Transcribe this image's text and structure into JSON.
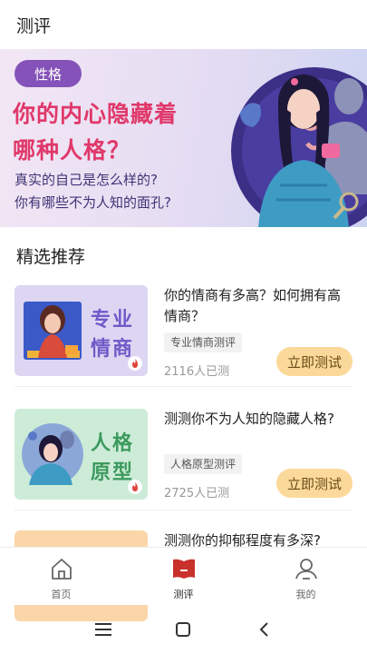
{
  "header": {
    "title": "测评"
  },
  "banner": {
    "tag": "性格",
    "headline_1": "你的内心隐藏着",
    "headline_2": "哪种人格？",
    "subline_1": "真实的自己是怎么样的?",
    "subline_2": "你有哪些不为人知的面孔?"
  },
  "section": {
    "title": "精选推荐"
  },
  "cards": [
    {
      "thumb_word_1": "专业",
      "thumb_word_2": "情商",
      "question": "你的情商有多高？如何拥有高情商？",
      "tag": "专业情商测评",
      "count": "2116人已测",
      "button": "立即测试",
      "thumb_color": "#dcd6f3",
      "word_color": "#6f5bc8"
    },
    {
      "thumb_word_1": "人格",
      "thumb_word_2": "原型",
      "question": "测测你不为人知的隐藏人格?",
      "tag": "人格原型测评",
      "count": "2725人已测",
      "button": "立即测试",
      "thumb_color": "#cdecd8",
      "word_color": "#3d9a5e"
    },
    {
      "question": "测测你的抑郁程度有多深?",
      "thumb_color": "#fbd6a8"
    }
  ],
  "tabbar": {
    "items": [
      {
        "label": "首页",
        "icon": "home-icon"
      },
      {
        "label": "测评",
        "icon": "test-book-icon",
        "active": true
      },
      {
        "label": "我的",
        "icon": "profile-icon"
      }
    ]
  },
  "colors": {
    "accent": "#c8312c",
    "tag_purple": "#8452b8",
    "headline_pink": "#e0386a",
    "button_bg": "#fbd99a"
  }
}
